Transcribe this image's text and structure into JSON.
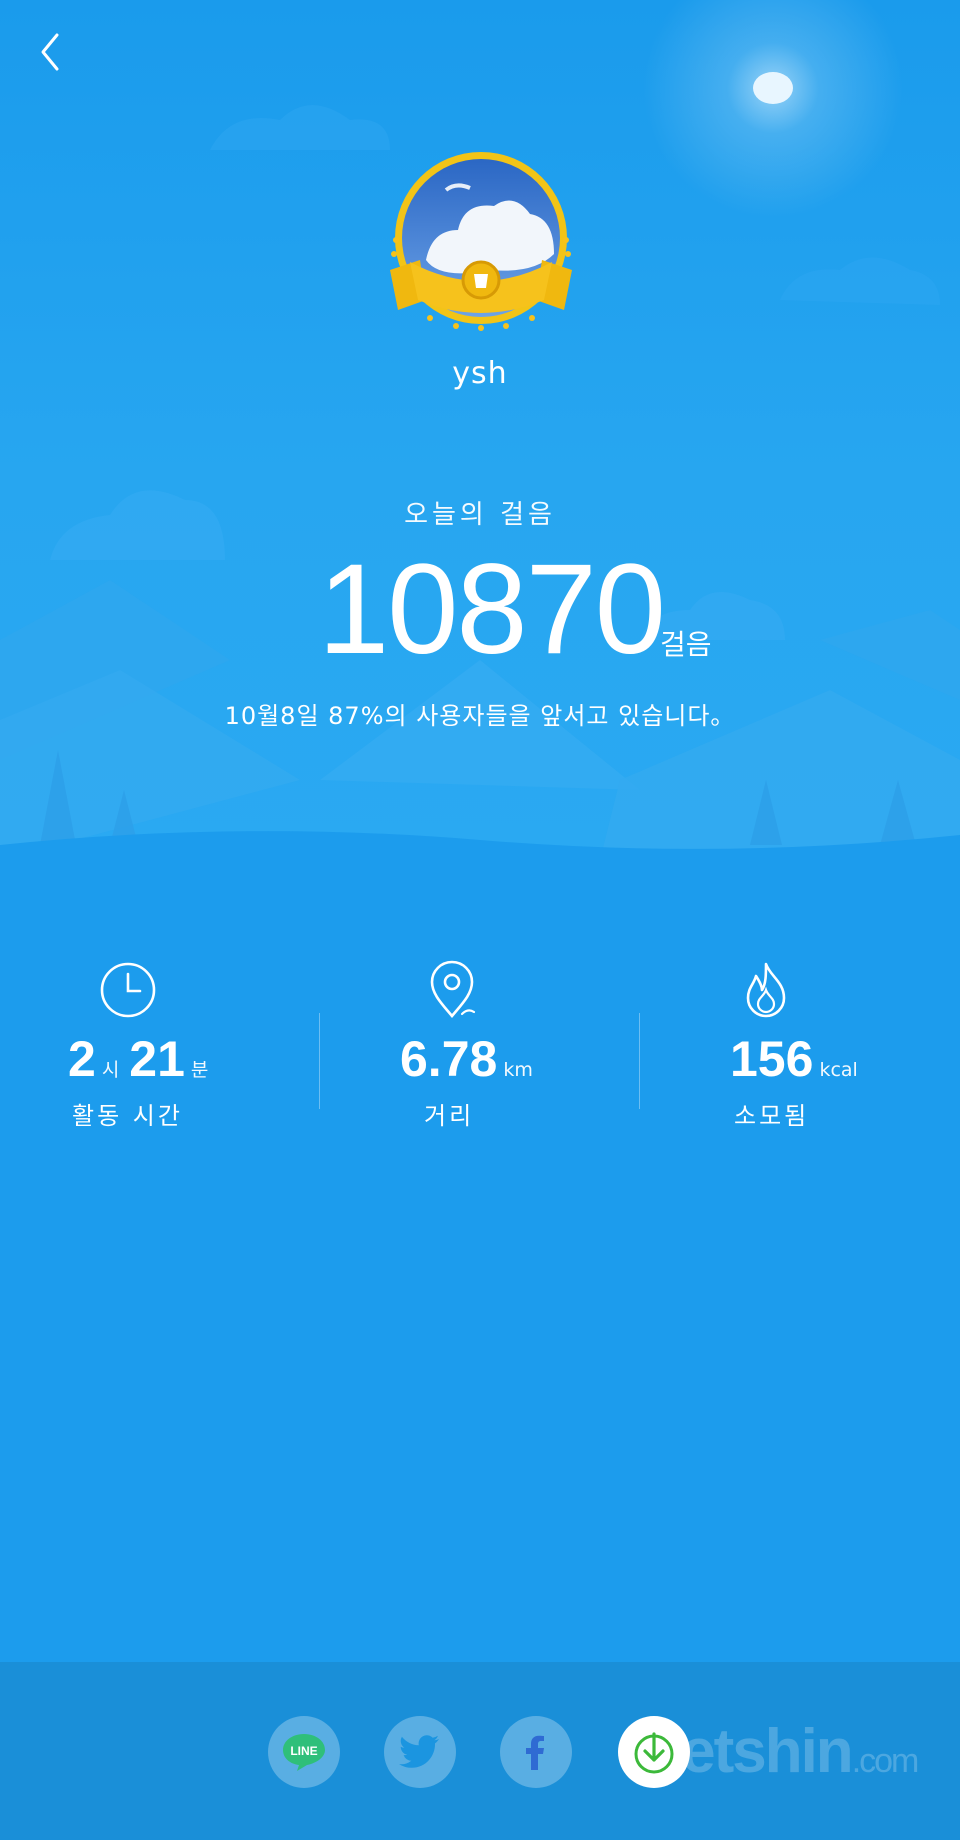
{
  "profile": {
    "username": "ysh"
  },
  "today": {
    "label": "오늘의 걸음",
    "steps": "10870",
    "steps_unit": "걸음",
    "rank_text": "10월8일 87%의 사용자들을 앞서고 있습니다。"
  },
  "stats": {
    "activity": {
      "hours": "2",
      "hours_unit": "시",
      "minutes": "21",
      "minutes_unit": "분",
      "label": "활동 시간",
      "icon": "clock-icon"
    },
    "distance": {
      "value": "6.78",
      "unit": "km",
      "label": "거리",
      "icon": "location-pin-icon"
    },
    "calories": {
      "value": "156",
      "unit": "kcal",
      "label": "소모됨",
      "icon": "flame-icon"
    }
  },
  "share": {
    "buttons": [
      {
        "name": "LINE",
        "icon": "line-icon"
      },
      {
        "name": "Twitter",
        "icon": "twitter-icon"
      },
      {
        "name": "Facebook",
        "icon": "facebook-icon"
      },
      {
        "name": "Save",
        "icon": "download-icon"
      }
    ],
    "line_label": "LINE"
  },
  "watermark": {
    "brand": "dietshin",
    "domain": ".com"
  },
  "colors": {
    "background": "#1c9ced",
    "badge_gold": "#f6c21c",
    "save_icon_green": "#3cb93a"
  }
}
